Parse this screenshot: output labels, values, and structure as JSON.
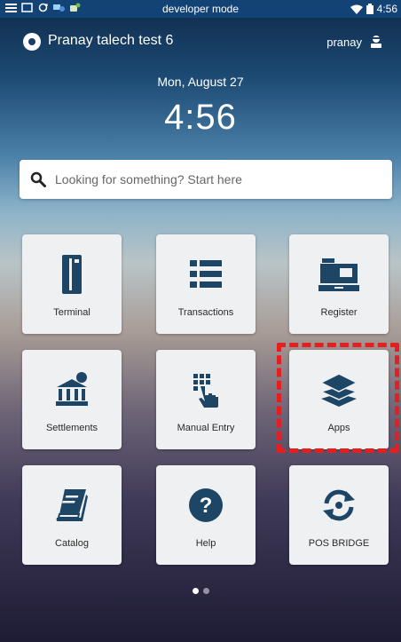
{
  "status_bar": {
    "mode_text": "developer mode",
    "time": "4:56"
  },
  "header": {
    "store_name": "Pranay talech test 6",
    "username": "pranay"
  },
  "clock": {
    "date": "Mon, August 27",
    "time": "4:56"
  },
  "search": {
    "placeholder": "Looking for something? Start here",
    "value": ""
  },
  "tiles": [
    {
      "label": "Terminal",
      "icon": "card-terminal-icon"
    },
    {
      "label": "Transactions",
      "icon": "list-icon"
    },
    {
      "label": "Register",
      "icon": "cash-register-icon"
    },
    {
      "label": "Settlements",
      "icon": "bank-icon"
    },
    {
      "label": "Manual Entry",
      "icon": "keypad-hand-icon"
    },
    {
      "label": "Apps",
      "icon": "layers-icon"
    },
    {
      "label": "Catalog",
      "icon": "book-icon"
    },
    {
      "label": "Help",
      "icon": "question-icon"
    },
    {
      "label": "POS BRIDGE",
      "icon": "sync-icon"
    }
  ],
  "pager": {
    "pages": 2,
    "active_index": 0
  },
  "colors": {
    "tile_icon": "#1d4566",
    "highlight": "#e51f1f",
    "status_bar": "#14467d"
  }
}
